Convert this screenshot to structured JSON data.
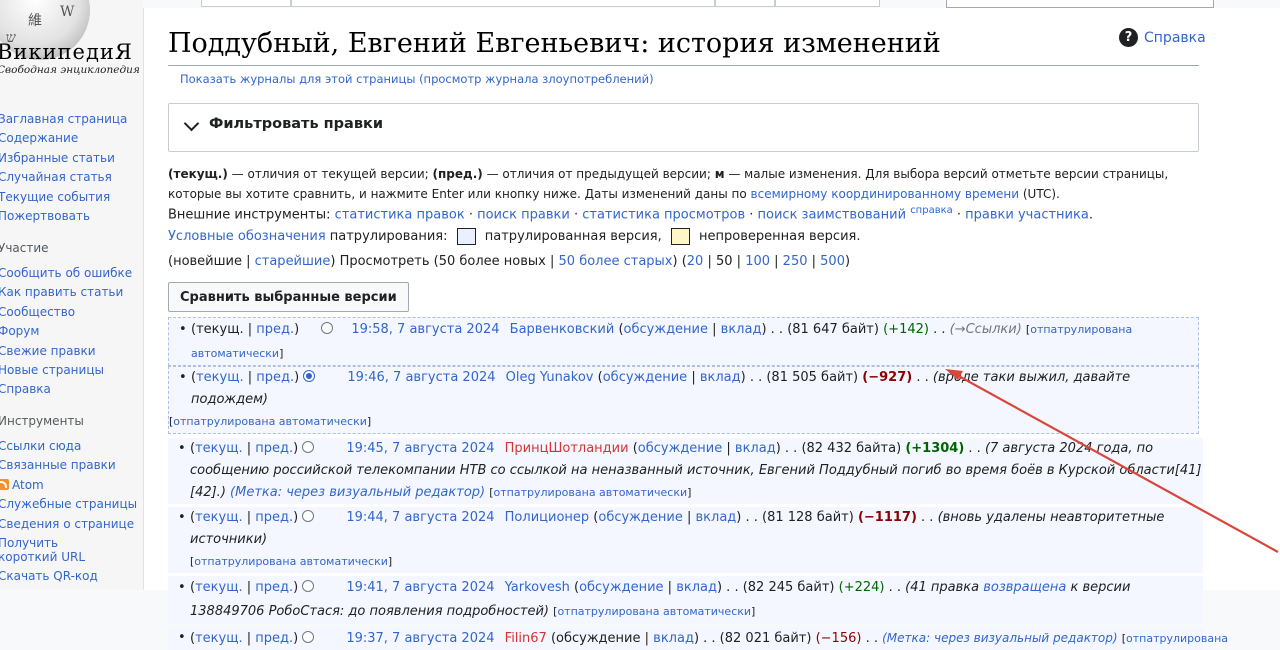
{
  "sidebar": {
    "logo_chars": [
      "維",
      "W",
      "ש"
    ],
    "wordmark": "ВикипедиЯ",
    "tagline": "Свободная энциклопедия",
    "nav": [
      "Заглавная страница",
      "Содержание",
      "Избранные статьи",
      "Случайная статья",
      "Текущие события",
      "Пожертвовать"
    ],
    "participation_heading": "Участие",
    "participation": [
      "Сообщить об ошибке",
      "Как править статьи",
      "Сообщество",
      "Форум",
      "Свежие правки",
      "Новые страницы",
      "Справка"
    ],
    "tools_heading": "Инструменты",
    "tools": [
      "Ссылки сюда",
      "Связанные правки",
      "Atom",
      "Служебные страницы",
      "Сведения о странице",
      "Получить короткий URL",
      "Скачать QR-код"
    ]
  },
  "header": {
    "title": "Поддубный, Евгений Евгеньевич: история изменений",
    "help": "Справка",
    "log_links": "Показать журналы для этой страницы (просмотр журнала злоупотреблений)"
  },
  "filter": {
    "label": "Фильтровать правки"
  },
  "legend": {
    "text1_bold": "(текущ.)",
    "text1": " — отличия от текущей версии; ",
    "text2_bold": "(пред.)",
    "text2": " — отличия от предыдущей версии; ",
    "text3_bold": "м",
    "text3": " — малые изменения. Для выбора версий отметьте версии страницы, которые вы хотите сравнить, и нажмите Enter или кнопку ниже. Даты изменений даны по ",
    "utc_link": "всемирному координированному времени",
    "text4": " (UTC)."
  },
  "external_tools": {
    "label": "Внешние инструменты: ",
    "links": [
      "статистика правок",
      "поиск правки",
      "статистика просмотров",
      "поиск заимствований"
    ],
    "sup": "справка",
    "last": "правки участника",
    "end": "."
  },
  "patrol": {
    "link": "Условные обозначения",
    "text": " патрулирования: ",
    "patrolled": " патрулированная версия, ",
    "unchecked": " непроверенная версия."
  },
  "pager": {
    "prefix": "(новейшие | ",
    "oldest": "старейшие",
    "mid": ") Просмотреть (50 более новых | ",
    "older": "50 более старых",
    "open": ") (",
    "n20": "20",
    "n50": "50",
    "n100": "100",
    "n250": "250",
    "n500": "500",
    "close": ")"
  },
  "compare_button": "Сравнить выбранные версии",
  "history": [
    {
      "cur": "текущ.",
      "prev": "пред.",
      "time": "19:58, 7 августа 2024",
      "user": "Барвенковский",
      "talk": "обсуждение",
      "contribs": "вклад",
      "size": "(81 647 байт)",
      "diff": "(+142)",
      "comment": "(→Ссылки)",
      "tag": "отпатрулирована автоматически"
    },
    {
      "cur": "текущ.",
      "prev": "пред.",
      "time": "19:46, 7 августа 2024",
      "user": "Oleg Yunakov",
      "talk": "обсуждение",
      "contribs": "вклад",
      "size": "(81 505 байт)",
      "diff": "(−927)",
      "comment": "(вроде таки выжил, давайте подождем)",
      "tag": "отпатрулирована автоматически"
    },
    {
      "cur": "текущ.",
      "prev": "пред.",
      "time": "19:45, 7 августа 2024",
      "user": "ПринцШотландии",
      "talk": "обсуждение",
      "contribs": "вклад",
      "size": "(82 432 байта)",
      "diff": "(+1304)",
      "comment": "(7 августа 2024 года, по сообщению российской телекомпании НТВ со ссылкой на неназванный источник, Евгений Поддубный погиб во время боёв в Курской области[41][42].)",
      "edit_tag": "(Метка: через визуальный редактор)",
      "tag": "отпатрулирована автоматически"
    },
    {
      "cur": "текущ.",
      "prev": "пред.",
      "time": "19:44, 7 августа 2024",
      "user": "Полиционер",
      "talk": "обсуждение",
      "contribs": "вклад",
      "size": "(81 128 байт)",
      "diff": "(−1117)",
      "comment": "(вновь удалены неавторитетные источники)",
      "tag": "отпатрулирована автоматически"
    },
    {
      "cur": "текущ.",
      "prev": "пред.",
      "time": "19:41, 7 августа 2024",
      "user": "Yarkovesh",
      "talk": "обсуждение",
      "contribs": "вклад",
      "size": "(82 245 байт)",
      "diff": "(+224)",
      "comment_pre": "(41 правка ",
      "comment_link": "возвращена",
      "comment_post": " к версии 138849706 РобоСтася: до появления подробностей)",
      "tag": "отпатрулирована автоматически"
    },
    {
      "cur": "текущ.",
      "prev": "пред.",
      "time": "19:37, 7 августа 2024",
      "user": "Filin67",
      "talk": "обсуждение",
      "contribs": "вклад",
      "size": "(82 021 байт)",
      "diff": "(−156)",
      "edit_tag": "(Метка: через визуальный редактор)",
      "tag": "отпатрулирована"
    }
  ],
  "colors": {
    "link": "#3366cc",
    "redlink": "#d73333",
    "positive": "#006400",
    "negative": "#8b0000",
    "arrow": "#d9463b"
  }
}
